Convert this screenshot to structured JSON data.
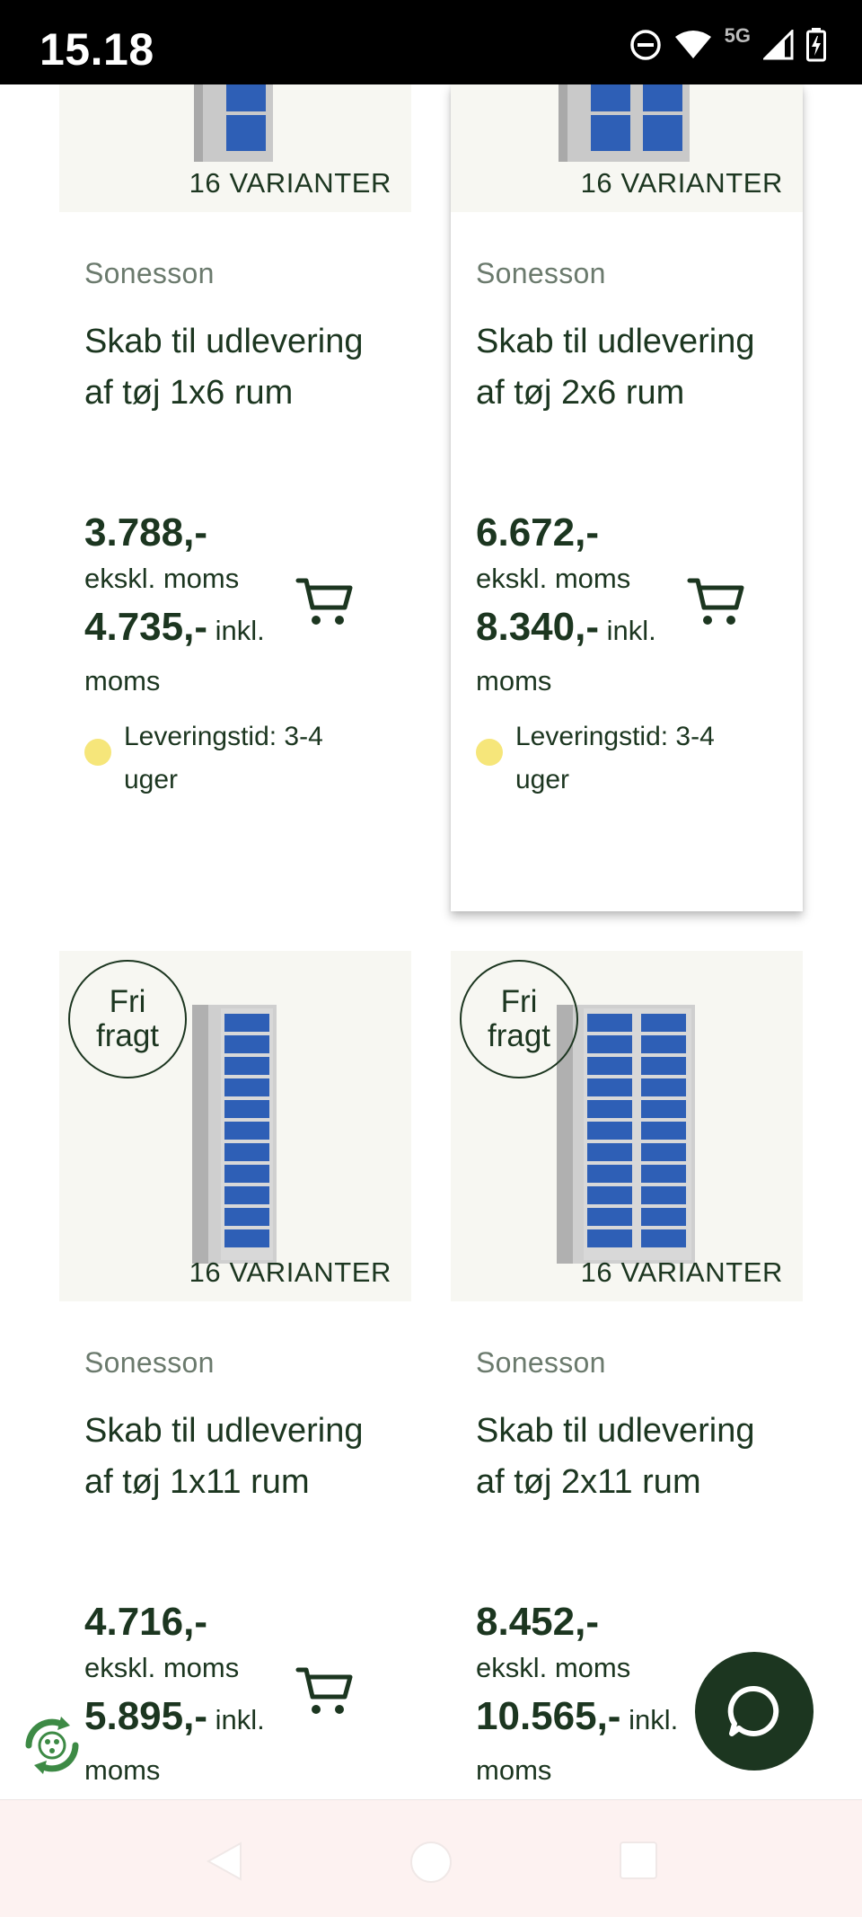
{
  "status_bar": {
    "time": "15.18",
    "network": "5G",
    "icons": [
      "do-not-disturb-icon",
      "wifi-icon",
      "signal-icon",
      "battery-charging-icon"
    ]
  },
  "products": [
    {
      "variants": "16 VARIANTER",
      "brand": "Sonesson",
      "title": "Skab til udlevering af tøj 1x6 rum",
      "price_excl": "3.788,-",
      "price_excl_label": "ekskl. moms",
      "price_incl": "4.735,-",
      "price_incl_label": "inkl. moms",
      "delivery": "Leveringstid: 3-4 uger",
      "delivery_status_color": "#f6e67a"
    },
    {
      "variants": "16 VARIANTER",
      "brand": "Sonesson",
      "title": "Skab til udlevering af tøj 2x6 rum",
      "price_excl": "6.672,-",
      "price_excl_label": "ekskl. moms",
      "price_incl": "8.340,-",
      "price_incl_label": "inkl. moms",
      "delivery": "Leveringstid: 3-4 uger",
      "delivery_status_color": "#f6e67a"
    },
    {
      "badge_line1": "Fri",
      "badge_line2": "fragt",
      "variants": "16 VARIANTER",
      "brand": "Sonesson",
      "title": "Skab til udlevering af tøj 1x11 rum",
      "price_excl": "4.716,-",
      "price_excl_label": "ekskl. moms",
      "price_incl": "5.895,-",
      "price_incl_label": "inkl. moms"
    },
    {
      "badge_line1": "Fri",
      "badge_line2": "fragt",
      "variants": "16 VARIANTER",
      "brand": "Sonesson",
      "title": "Skab til udlevering af tøj 2x11 rum",
      "price_excl": "8.452,-",
      "price_excl_label": "ekskl. moms",
      "price_incl": "10.565,-",
      "price_incl_label": "inkl. moms"
    }
  ],
  "colors": {
    "brand_dark_green": "#1c3620",
    "image_background": "#f7f7f2",
    "delivery_dot_yellow": "#f6e67a",
    "cabinet_door_blue": "#2e5fb6",
    "nav_bar_background": "#fdf2f1"
  },
  "floating": {
    "chat_icon": "chat-bubble-icon",
    "eco_icon": "recycle-badge-icon"
  },
  "nav_bar": {
    "buttons": [
      "back-icon",
      "home-icon",
      "recents-icon"
    ]
  }
}
